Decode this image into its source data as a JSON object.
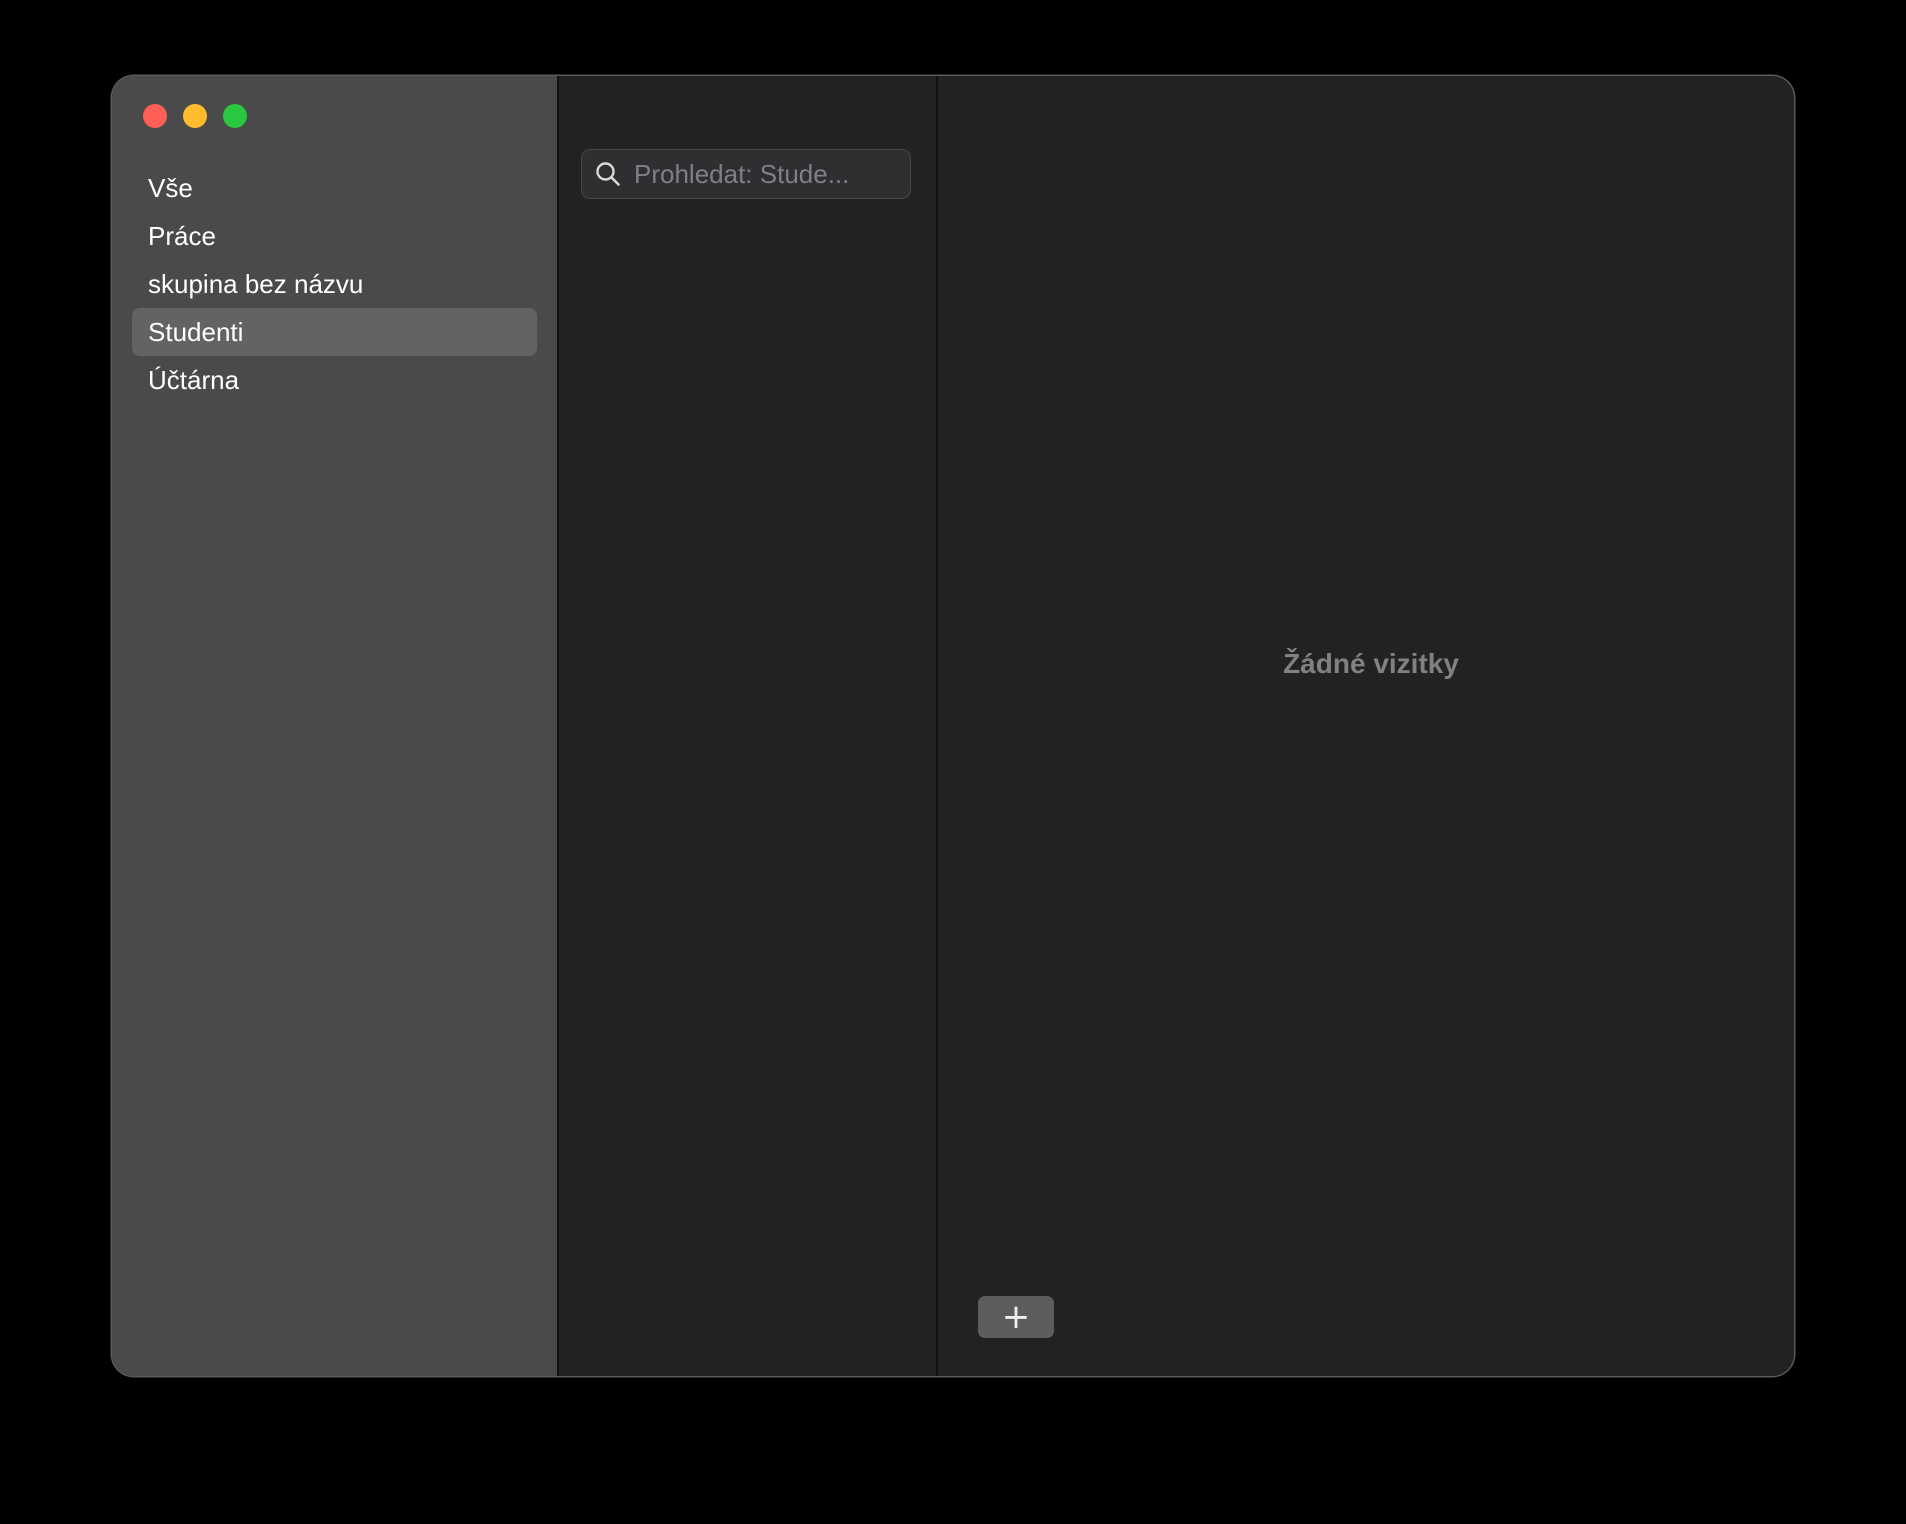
{
  "window": {
    "controls": [
      "close",
      "minimize",
      "maximize"
    ]
  },
  "sidebar": {
    "groups": [
      {
        "label": "Vše",
        "selected": false
      },
      {
        "label": "Práce",
        "selected": false
      },
      {
        "label": "skupina bez názvu",
        "selected": false
      },
      {
        "label": "Studenti",
        "selected": true
      },
      {
        "label": "Účtárna",
        "selected": false
      }
    ]
  },
  "list": {
    "search": {
      "placeholder": "Prohledat: Stude...",
      "value": "",
      "icon": "search-icon"
    }
  },
  "detail": {
    "empty_text": "Žádné vizitky",
    "add_button_label": "+",
    "add_button_icon": "plus-icon"
  },
  "colors": {
    "close": "#ff5f57",
    "minimize": "#febc2e",
    "maximize": "#28c840",
    "sidebar_bg": "#4a4a4a",
    "selected_bg": "#636365",
    "pane_bg": "#212224"
  }
}
